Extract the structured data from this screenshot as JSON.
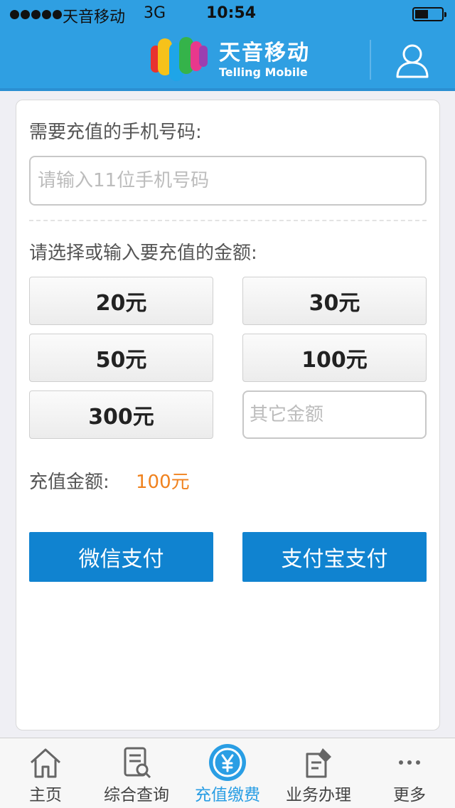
{
  "status_bar": {
    "carrier": "天音移动",
    "network": "3G",
    "time": "10:54"
  },
  "header": {
    "logo_cn": "天音移动",
    "logo_en": "Telling Mobile",
    "user_icon": "user-icon"
  },
  "form": {
    "phone_label": "需要充值的手机号码:",
    "phone_placeholder": "请输入11位手机号码",
    "amount_label": "请选择或输入要充值的金额:",
    "amounts": [
      "20元",
      "30元",
      "50元",
      "100元",
      "300元"
    ],
    "other_placeholder": "其它金额",
    "total_label": "充值金额:",
    "total_value": "100元"
  },
  "payment": {
    "wechat_label": "微信支付",
    "alipay_label": "支付宝支付"
  },
  "tabs": [
    {
      "label": "主页",
      "icon": "home-icon"
    },
    {
      "label": "综合查询",
      "icon": "query-icon"
    },
    {
      "label": "充值缴费",
      "icon": "yuan-icon",
      "active": true
    },
    {
      "label": "业务办理",
      "icon": "business-icon"
    },
    {
      "label": "更多",
      "icon": "more-icon"
    }
  ],
  "colors": {
    "header_bg": "#2f9fe2",
    "primary_button": "#1083d0",
    "amount_highlight": "#f0821e",
    "active_tab": "#2a9ee4"
  }
}
